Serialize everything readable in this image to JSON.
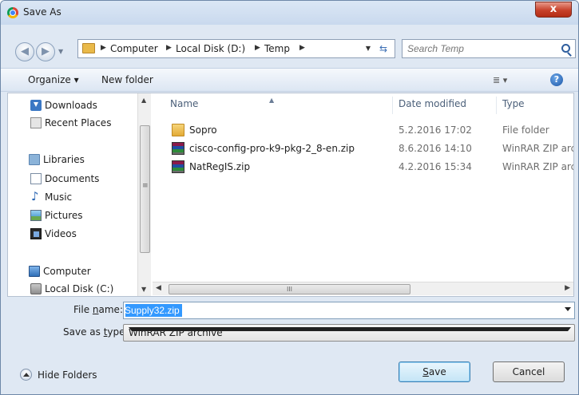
{
  "window": {
    "title": "Save As",
    "close_label": "x"
  },
  "address": {
    "crumbs": [
      "Computer",
      "Local Disk (D:)",
      "Temp"
    ],
    "search_placeholder": "Search Temp"
  },
  "toolbar": {
    "organize_label": "Organize ▾",
    "new_folder_label": "New folder",
    "view_label": "≣ ▾",
    "help_label": "?"
  },
  "nav_pane": {
    "items": [
      {
        "label": "Downloads",
        "icon": "downloads-icon"
      },
      {
        "label": "Recent Places",
        "icon": "recent-places-icon"
      },
      {
        "label": "Libraries",
        "icon": "libraries-icon"
      },
      {
        "label": "Documents",
        "icon": "documents-icon"
      },
      {
        "label": "Music",
        "icon": "music-icon"
      },
      {
        "label": "Pictures",
        "icon": "pictures-icon"
      },
      {
        "label": "Videos",
        "icon": "videos-icon"
      },
      {
        "label": "Computer",
        "icon": "computer-icon"
      },
      {
        "label": "Local Disk (C:)",
        "icon": "local-disk-icon"
      }
    ]
  },
  "files": {
    "columns": {
      "name": "Name",
      "date": "Date modified",
      "type": "Type"
    },
    "rows": [
      {
        "name": "Sopro",
        "date": "5.2.2016 17:02",
        "type": "File folder",
        "icon": "folder-icon"
      },
      {
        "name": "cisco-config-pro-k9-pkg-2_8-en.zip",
        "date": "8.6.2016 14:10",
        "type": "WinRAR ZIP archive",
        "icon": "zip-icon"
      },
      {
        "name": "NatRegIS.zip",
        "date": "4.2.2016 15:34",
        "type": "WinRAR ZIP archive",
        "icon": "zip-icon"
      }
    ]
  },
  "form": {
    "file_name_label_pre": "File ",
    "file_name_label_u": "n",
    "file_name_label_post": "ame:",
    "file_name_value": "Supply32.zip",
    "save_type_label_pre": "Save as ",
    "save_type_label_u": "t",
    "save_type_label_post": "ype:",
    "save_type_value": "WinRAR ZIP archive"
  },
  "footer": {
    "hide_folders_label": "Hide Folders",
    "save_label_u": "S",
    "save_label_rest": "ave",
    "cancel_label": "Cancel"
  }
}
